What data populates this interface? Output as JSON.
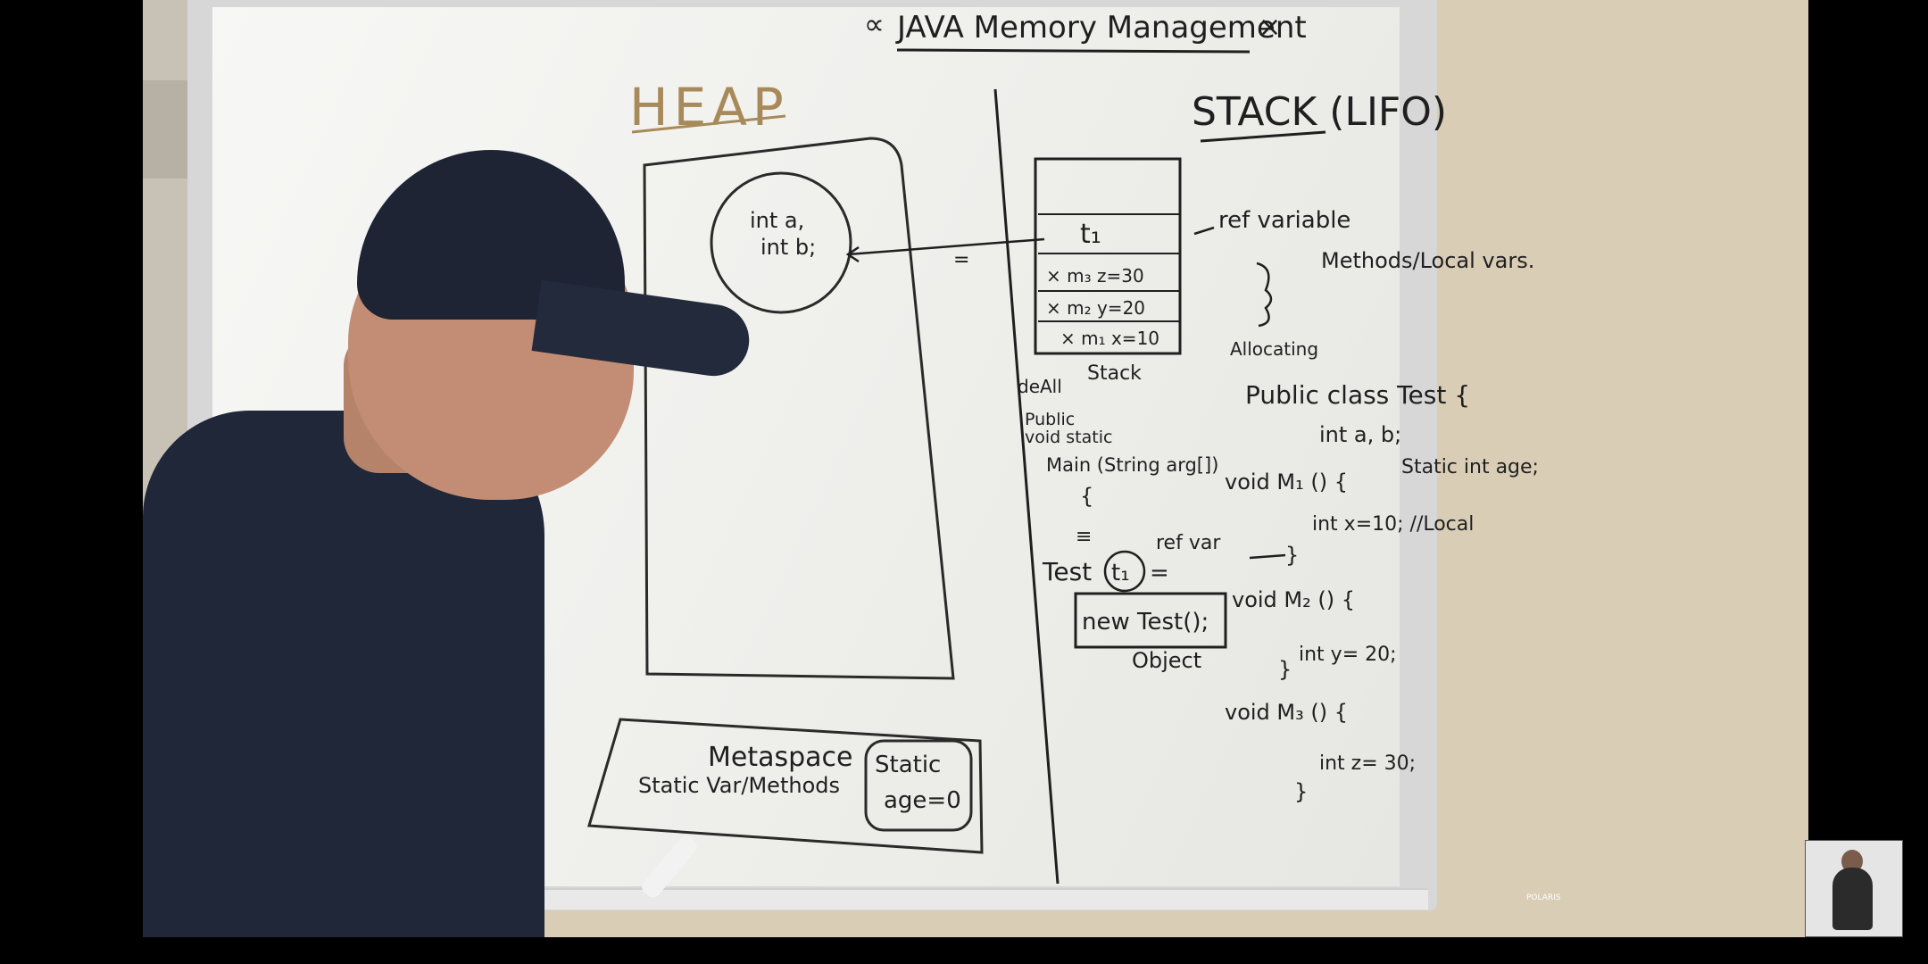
{
  "board": {
    "title": "JAVA Memory Management",
    "title_marks": [
      "∝",
      "×"
    ],
    "heap": {
      "label": "HEAP",
      "object_fields": [
        "int a,",
        "int b;"
      ],
      "metaspace": {
        "label": "Metaspace",
        "sub_label": "Static Var/Methods",
        "static_box": [
          "Static",
          "age=0"
        ]
      },
      "equals_mark": "="
    },
    "stack": {
      "label": "STACK (LIFO)",
      "ref_variable_label": "ref variable",
      "methods_label": "Methods/Local vars.",
      "allocating_label": "Allocating",
      "deallocate_label": "deAll",
      "stack_label": "Stack",
      "cells": [
        {
          "label": ""
        },
        {
          "label": "t₁"
        },
        {
          "label": "× m₃  z=30"
        },
        {
          "label": "× m₂  y=20"
        },
        {
          "label": "× m₁  x=10"
        }
      ]
    },
    "main_code": {
      "lines": [
        "Public",
        "void static",
        "Main (String arg[])",
        "{",
        "≡"
      ],
      "statement": "Test",
      "ref": "t₁",
      "equals": "=",
      "ref_var_note": "ref var",
      "new_expr": "new Test();",
      "object_label": "Object"
    },
    "class_code": {
      "lines": [
        "Public class Test {",
        "int a, b;",
        "Static int age;",
        "void M₁ () {",
        "int x=10; //Local",
        "}",
        "void M₂ () {",
        "int y= 20;",
        "}",
        "void M₃ () {",
        "int z= 30;",
        "}"
      ]
    },
    "tray_brand": "POLARIS"
  },
  "colors": {
    "ink": "#1f1f1f",
    "heap_ink": "#a88a5a",
    "board": "#f2f2ef",
    "wall": "#d9cdb6",
    "shirt": "#1f2738"
  },
  "icons": {
    "marker": "marker-icon",
    "webcam": "webcam-thumbnail"
  }
}
